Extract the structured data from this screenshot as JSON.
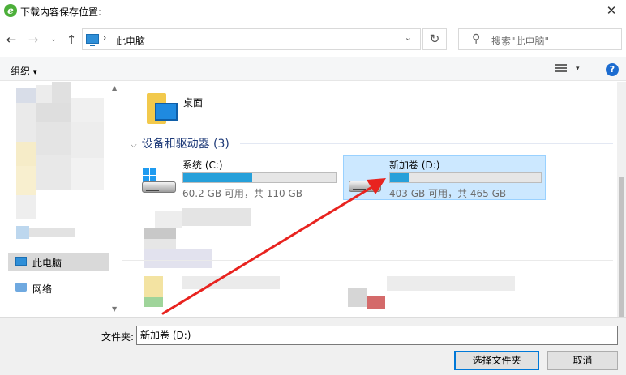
{
  "window": {
    "title": "下载内容保存位置:",
    "app_icon": "ie-e-icon",
    "close_glyph": "✕"
  },
  "nav": {
    "back_glyph": "←",
    "forward_glyph": "→",
    "recent_glyph": "⌄",
    "up_glyph": "↑",
    "address_separator": "›",
    "address_path": "此电脑",
    "address_dropdown": "⌄",
    "refresh_glyph": "↻",
    "search_placeholder": "搜索\"此电脑\"",
    "search_glyph": "⚲"
  },
  "toolbar": {
    "organize_label": "组织",
    "organize_caret": "▾",
    "view_caret": "▾",
    "help_glyph": "?"
  },
  "navpane": {
    "items": [
      {
        "label": "此电脑",
        "icon": "computer-icon",
        "selected": true
      },
      {
        "label": "网络",
        "icon": "network-icon",
        "selected": false
      }
    ],
    "scroll_up": "▲",
    "scroll_down": "▼"
  },
  "content": {
    "folders": [
      {
        "label": "桌面",
        "icon": "desktop-folder-icon"
      }
    ],
    "section_title": "设备和驱动器 (3)",
    "section_caret": "⌵",
    "drives": [
      {
        "name": "系统 (C:)",
        "info": "60.2 GB 可用，共 110 GB",
        "used_fraction": 0.45,
        "icon": "windows-drive-icon",
        "selected": false
      },
      {
        "name": "新加卷 (D:)",
        "info": "403 GB 可用，共 465 GB",
        "used_fraction": 0.13,
        "icon": "hard-drive-icon",
        "selected": true
      }
    ]
  },
  "bottom": {
    "folder_label": "文件夹:",
    "folder_value": "新加卷 (D:)",
    "select_button": "选择文件夹",
    "cancel_button": "取消"
  },
  "colors": {
    "accent": "#0078d7",
    "selection_bg": "#cce8ff",
    "progress_fill": "#26a0da",
    "annotation_arrow": "#e8231f",
    "section_heading": "#1e3a78"
  }
}
